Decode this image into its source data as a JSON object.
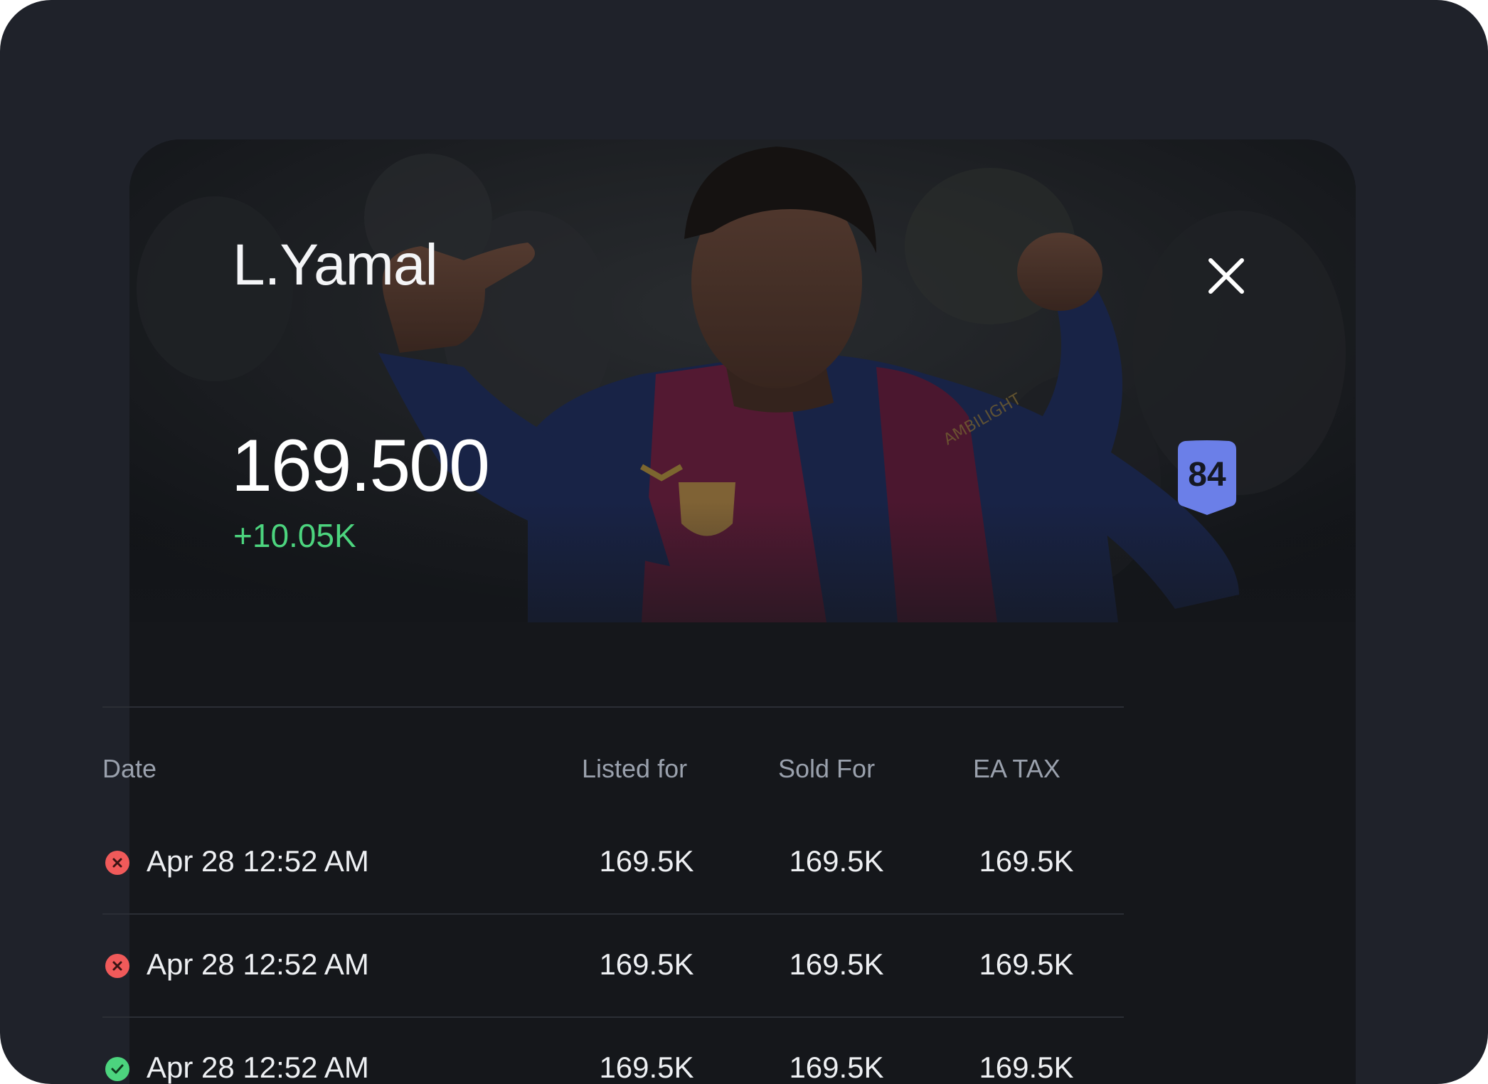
{
  "player": {
    "name": "L.Yamal",
    "price": "169.500",
    "price_change": "+10.05K",
    "rating": "84"
  },
  "colors": {
    "background": "#1f222a",
    "card": "#15171b",
    "positive": "#4cd47e",
    "negative": "#f05a5a",
    "rating_badge": "#6b7fe8"
  },
  "icons": {
    "close": "close-icon",
    "failed": "x-circle-icon",
    "success": "check-circle-icon"
  },
  "table": {
    "headers": {
      "date": "Date",
      "listed": "Listed for",
      "sold": "Sold For",
      "tax": "EA TAX"
    },
    "rows": [
      {
        "status": "failed",
        "date": "Apr 28 12:52 AM",
        "listed": "169.5K",
        "sold": "169.5K",
        "tax": "169.5K"
      },
      {
        "status": "failed",
        "date": "Apr 28 12:52 AM",
        "listed": "169.5K",
        "sold": "169.5K",
        "tax": "169.5K"
      },
      {
        "status": "success",
        "date": "Apr 28 12:52 AM",
        "listed": "169.5K",
        "sold": "169.5K",
        "tax": "169.5K"
      }
    ]
  }
}
